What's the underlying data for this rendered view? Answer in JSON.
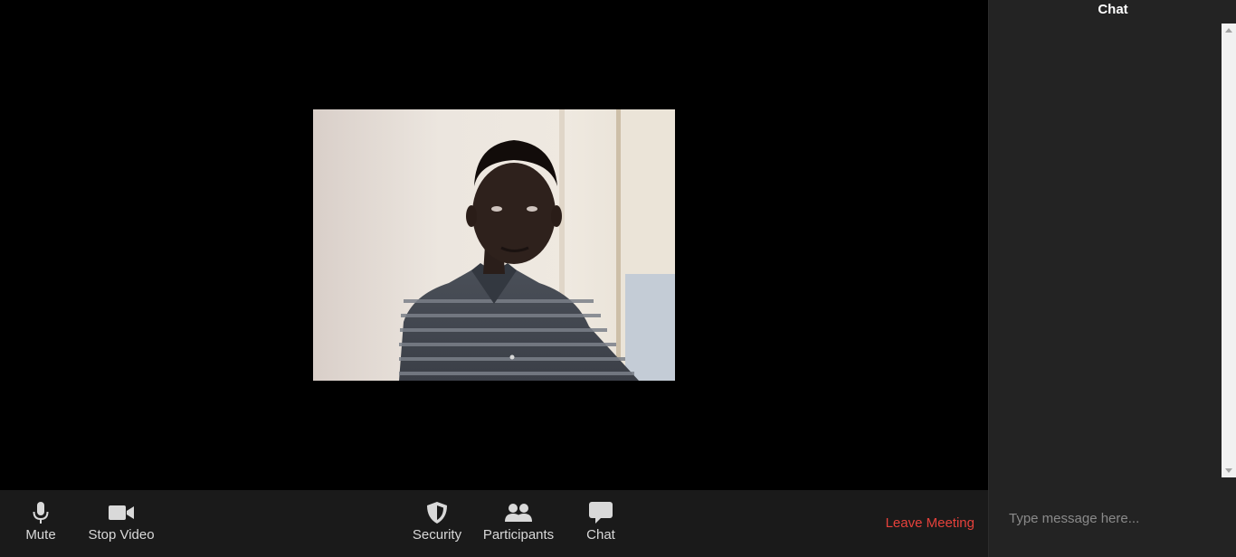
{
  "toolbar": {
    "mute_label": "Mute",
    "stop_video_label": "Stop Video",
    "security_label": "Security",
    "participants_label": "Participants",
    "chat_label": "Chat",
    "leave_label": "Leave Meeting"
  },
  "icons": {
    "mute": "microphone-icon",
    "stop_video": "video-camera-icon",
    "security": "shield-icon",
    "participants": "participants-icon",
    "chat": "chat-bubble-icon"
  },
  "chat_panel": {
    "title": "Chat",
    "input_placeholder": "Type message here..."
  },
  "colors": {
    "leave_red": "#e5413b",
    "toolbar_bg": "#1a1a1a",
    "panel_bg": "#232323"
  }
}
